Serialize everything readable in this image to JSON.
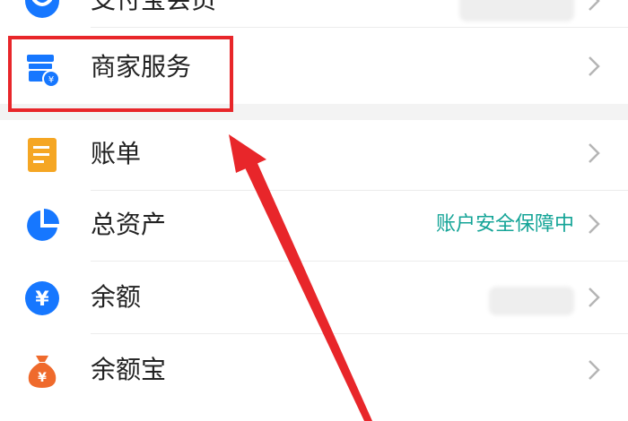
{
  "menu": {
    "items": [
      {
        "id": "alipay",
        "label": "支付宝会员",
        "icon": "alipay-member-icon",
        "color": "#1677ff"
      },
      {
        "id": "merchant",
        "label": "商家服务",
        "icon": "store-icon",
        "color": "#1677ff"
      },
      {
        "id": "bill",
        "label": "账单",
        "icon": "bill-icon",
        "color": "#f5a623"
      },
      {
        "id": "assets",
        "label": "总资产",
        "icon": "pie-chart-icon",
        "color": "#1677ff",
        "status": "账户安全保障中"
      },
      {
        "id": "balance",
        "label": "余额",
        "icon": "yuan-icon",
        "color": "#1677ff"
      },
      {
        "id": "yuebao",
        "label": "余额宝",
        "icon": "money-bag-icon",
        "color": "#ef6a2c"
      }
    ]
  },
  "colors": {
    "highlight": "#e8262a",
    "status_text": "#14a497"
  }
}
